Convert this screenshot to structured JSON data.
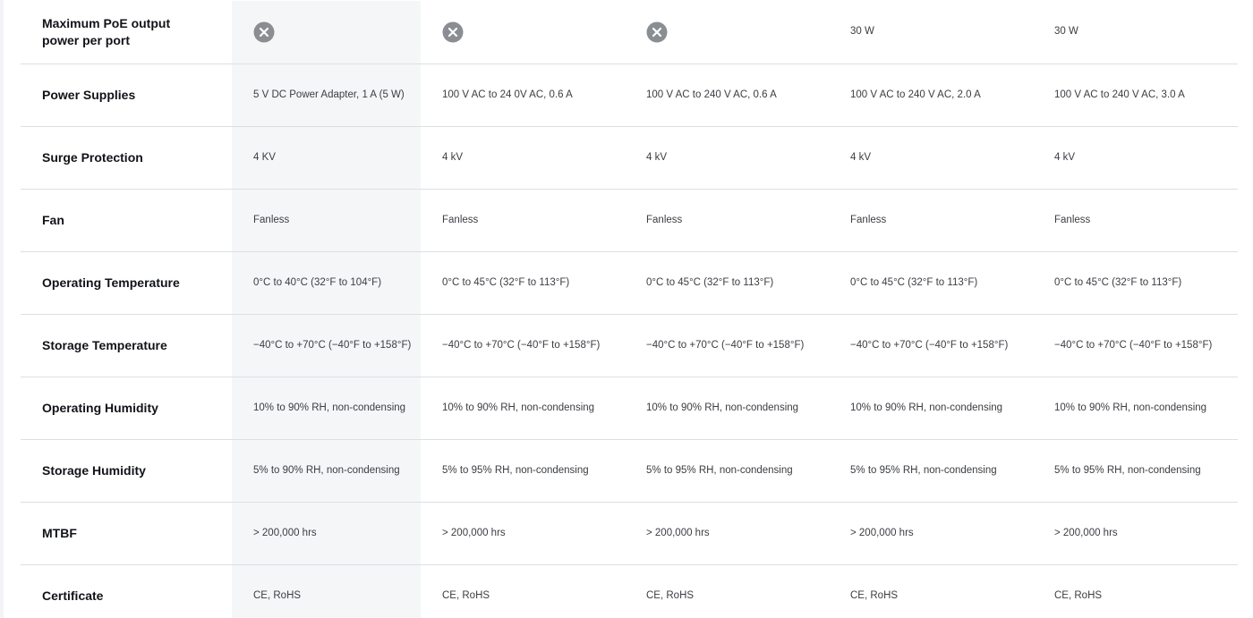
{
  "colors": {
    "highlight_column": "#f5f6f8",
    "divider": "#dcdfe3",
    "x_icon_fill": "#8a8d91"
  },
  "rows": [
    {
      "label": "Maximum PoE output power per port",
      "values": [
        "x-circle-icon",
        "x-circle-icon",
        "x-circle-icon",
        "30 W",
        "30 W"
      ]
    },
    {
      "label": "Power Supplies",
      "values": [
        "5 V DC Power Adapter, 1 A (5 W)",
        "100 V AC to 24 0V AC, 0.6 A",
        "100 V AC to 240 V AC, 0.6 A",
        "100 V AC to 240 V AC, 2.0 A",
        "100 V AC to 240 V AC, 3.0 A"
      ]
    },
    {
      "label": "Surge Protection",
      "values": [
        "4 KV",
        "4 kV",
        "4 kV",
        "4 kV",
        "4 kV"
      ]
    },
    {
      "label": "Fan",
      "values": [
        "Fanless",
        "Fanless",
        "Fanless",
        "Fanless",
        "Fanless"
      ]
    },
    {
      "label": "Operating Temperature",
      "values": [
        "0°C to 40°C (32°F to 104°F)",
        "0°C to 45°C (32°F to 113°F)",
        "0°C to 45°C (32°F to 113°F)",
        "0°C to 45°C (32°F to 113°F)",
        "0°C to 45°C (32°F to 113°F)"
      ]
    },
    {
      "label": "Storage Temperature",
      "values": [
        "−40°C to +70°C (−40°F to +158°F)",
        "−40°C to +70°C (−40°F to +158°F)",
        "−40°C to +70°C (−40°F to +158°F)",
        "−40°C to +70°C (−40°F to +158°F)",
        "−40°C to +70°C (−40°F to +158°F)"
      ]
    },
    {
      "label": "Operating Humidity",
      "values": [
        "10% to 90% RH, non-condensing",
        "10% to 90% RH, non-condensing",
        "10% to 90% RH, non-condensing",
        "10% to 90% RH, non-condensing",
        "10% to 90% RH, non-condensing"
      ]
    },
    {
      "label": "Storage Humidity",
      "values": [
        "5% to 90% RH, non-condensing",
        "5% to 95% RH, non-condensing",
        "5% to 95% RH, non-condensing",
        "5% to 95% RH, non-condensing",
        "5% to 95% RH, non-condensing"
      ]
    },
    {
      "label": "MTBF",
      "values": [
        "> 200,000 hrs",
        "> 200,000 hrs",
        "> 200,000 hrs",
        "> 200,000 hrs",
        "> 200,000 hrs"
      ]
    },
    {
      "label": "Certificate",
      "values": [
        "CE, RoHS",
        "CE, RoHS",
        "CE, RoHS",
        "CE, RoHS",
        "CE, RoHS"
      ]
    }
  ]
}
